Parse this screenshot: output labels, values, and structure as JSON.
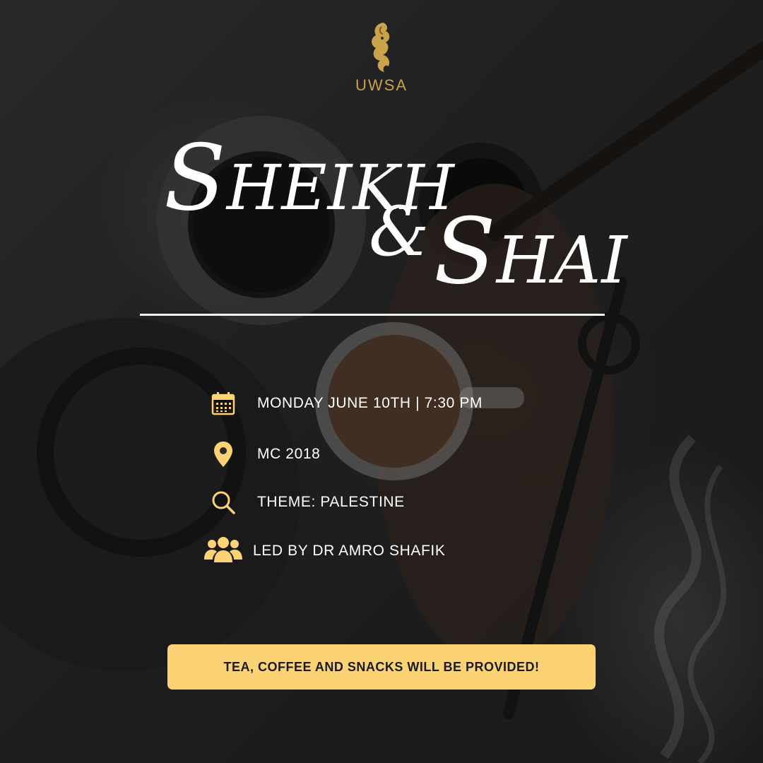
{
  "logo": {
    "text": "UWSA"
  },
  "title": {
    "word1_cap": "S",
    "word1_rest": "HEIKH",
    "ampersand": "&",
    "word2_cap": "S",
    "word2_rest": "HAI"
  },
  "details": [
    {
      "icon": "calendar-icon",
      "text": "MONDAY JUNE 10TH  | 7:30 PM"
    },
    {
      "icon": "location-pin-icon",
      "text": "MC 2018"
    },
    {
      "icon": "search-icon",
      "text": "THEME: PALESTINE"
    },
    {
      "icon": "people-icon",
      "text": "LED BY DR AMRO SHAFIK"
    }
  ],
  "banner": {
    "text": "TEA, COFFEE AND SNACKS WILL BE PROVIDED!"
  },
  "colors": {
    "accent": "#fcd374",
    "gold": "#c9a24a",
    "text": "#ffffff",
    "background": "#2a2a2c"
  }
}
